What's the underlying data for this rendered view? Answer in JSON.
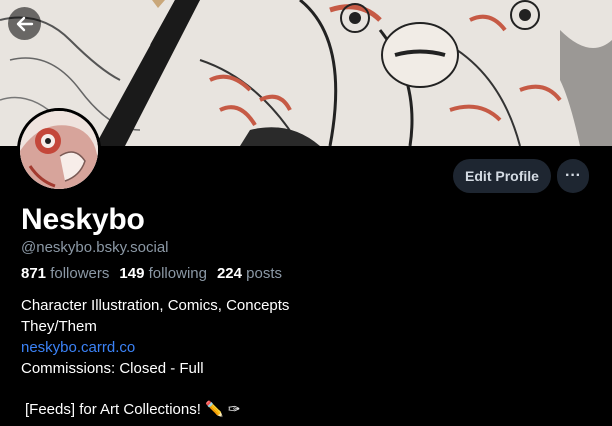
{
  "profile": {
    "display_name": "Neskybo",
    "handle": "@neskybo.bsky.social",
    "stats": {
      "followers_count": "871",
      "followers_label": "followers",
      "following_count": "149",
      "following_label": "following",
      "posts_count": "224",
      "posts_label": "posts"
    },
    "bio": {
      "line1": "Character Illustration, Comics, Concepts",
      "line2": "They/Them",
      "link": "neskybo.carrd.co",
      "line4": "Commissions: Closed - Full",
      "feeds_line": "[Feeds] for Art Collections! ✏️ ✑"
    }
  },
  "actions": {
    "edit_profile_label": "Edit Profile",
    "more_label": "···"
  },
  "icons": {
    "back": "arrow-left-icon",
    "more": "ellipsis-icon"
  },
  "colors": {
    "background": "#000000",
    "button_bg": "#1e2631",
    "secondary_text": "#8b98a5",
    "link": "#3b82f6"
  }
}
